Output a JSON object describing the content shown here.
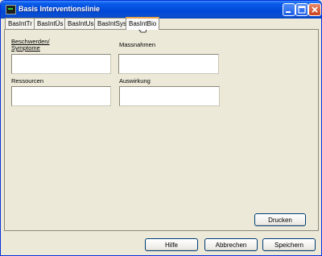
{
  "window": {
    "title": "Basis Interventionslinie"
  },
  "tabs": [
    {
      "label": "BasIntTr"
    },
    {
      "label": "BasIntÜs"
    },
    {
      "label": "BasIntUs"
    },
    {
      "label": "BasIntSys"
    },
    {
      "label": "BasIntBio",
      "active": true
    }
  ],
  "fields": {
    "beschwerden_label_line1": "Beschwerden/",
    "beschwerden_label_line2": "Symptome",
    "massnahmen_label": "Massnahmen",
    "ressourcen_label": "Ressourcen",
    "auswirkung_label": "Auswirkung"
  },
  "buttons": {
    "drucken": "Drucken",
    "hilfe": "Hilfe",
    "abbrechen": "Abbrechen",
    "speichern": "Speichern"
  },
  "icons": {
    "app": "console-app-icon",
    "minimize": "minimize-icon",
    "maximize": "maximize-icon",
    "close": "close-icon",
    "cursor": "hand-cursor-icon"
  }
}
